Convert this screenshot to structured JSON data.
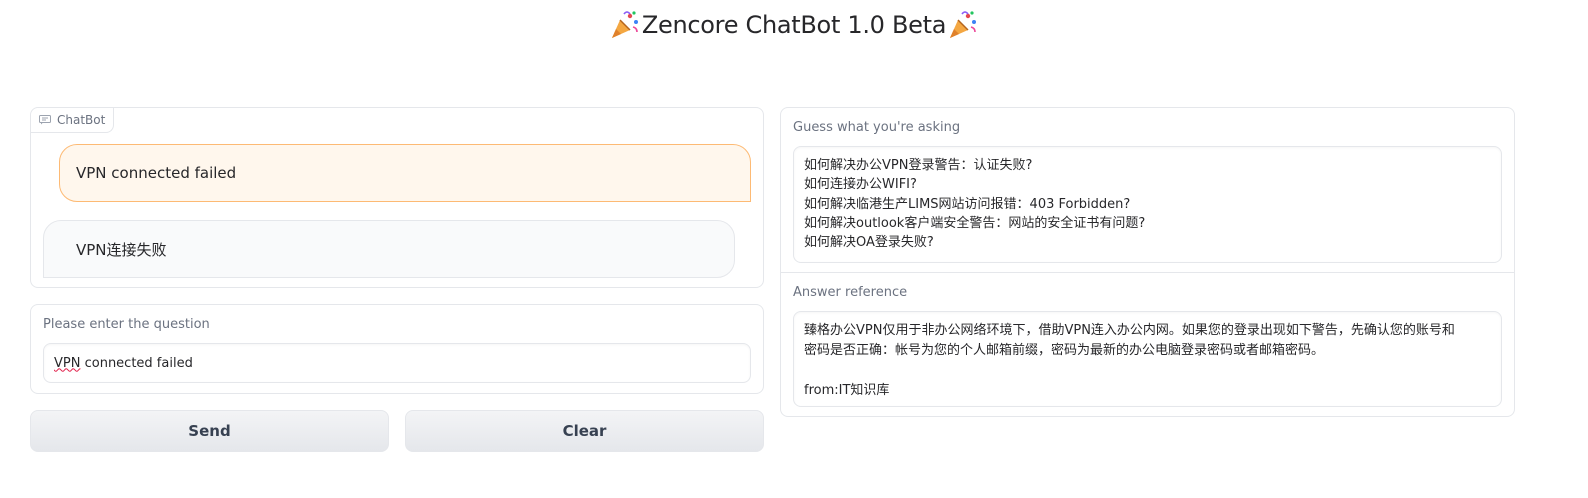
{
  "header": {
    "title": "Zencore ChatBot 1.0 Beta",
    "emoji": "party-popper-icon"
  },
  "chatbot": {
    "label": "ChatBot",
    "messages": [
      {
        "role": "user",
        "text": "VPN connected failed"
      },
      {
        "role": "bot",
        "text": "VPN连接失败"
      }
    ]
  },
  "question": {
    "label": "Please enter the question",
    "value_underlined": "VPN",
    "value_rest": " connected failed"
  },
  "buttons": {
    "send": "Send",
    "clear": "Clear"
  },
  "guess": {
    "label": "Guess what you're asking",
    "lines": [
      "如何解决办公VPN登录警告：认证失败?",
      "如何连接办公WIFI?",
      "如何解决临港生产LIMS网站访问报错：403 Forbidden?",
      "如何解决outlook客户端安全警告：网站的安全证书有问题?",
      "如何解决OA登录失败?"
    ]
  },
  "answer": {
    "label": "Answer reference",
    "lines": [
      "臻格办公VPN仅用于非办公网络环境下，借助VPN连入办公内网。如果您的登录出现如下警告，先确认您的账号和",
      "密码是否正确：帐号为您的个人邮箱前缀，密码为最新的办公电脑登录密码或者邮箱密码。",
      "",
      "from:IT知识库"
    ]
  }
}
